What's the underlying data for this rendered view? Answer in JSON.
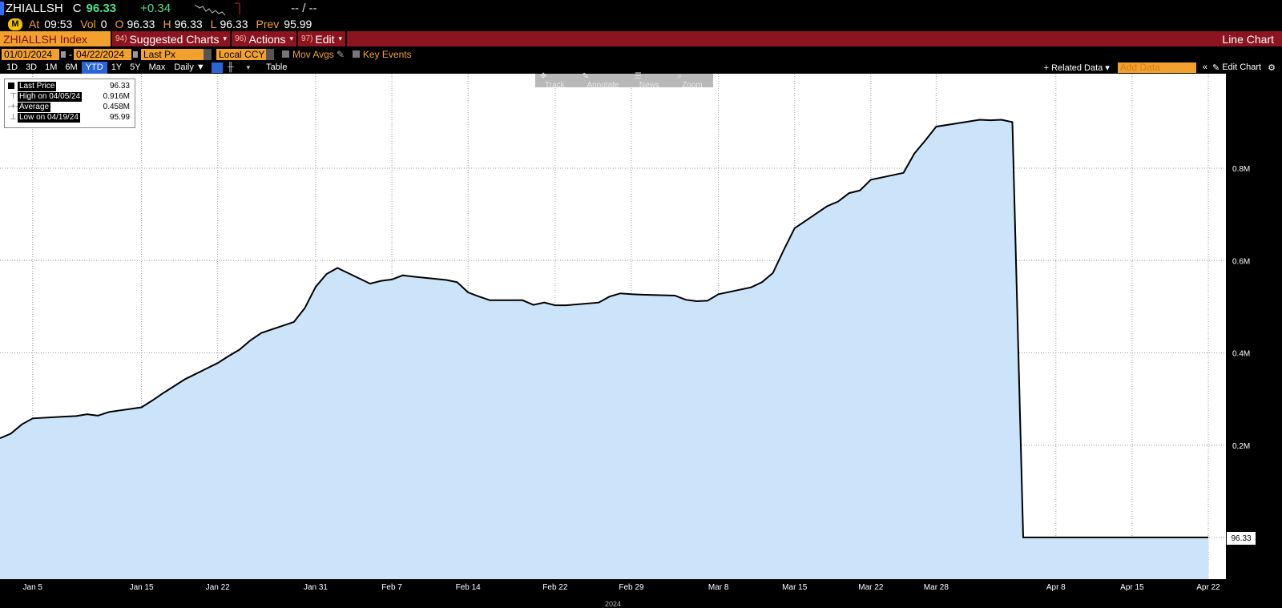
{
  "header": {
    "ticker": "ZHIALLSH",
    "c_label": "C",
    "last": "96.33",
    "change": "+0.34",
    "dashes": "-- / --",
    "at_label": "At",
    "time": "09:53",
    "vol_label": "Vol",
    "vol": "0",
    "o_label": "O",
    "open": "96.33",
    "h_label": "H",
    "high": "96.33",
    "l_label": "L",
    "low": "96.33",
    "prev_label": "Prev",
    "prev": "95.99"
  },
  "menubar": {
    "security": "ZHIALLSH Index",
    "suggested_num": "94)",
    "suggested": "Suggested Charts",
    "actions_num": "96)",
    "actions": "Actions",
    "edit_num": "97)",
    "edit": "Edit",
    "chart_type": "Line Chart"
  },
  "settings": {
    "start_date": "01/01/2024",
    "end_date": "04/22/2024",
    "field": "Last Px",
    "currency": "Local CCY",
    "mov_avgs": "Mov Avgs",
    "key_events": "Key Events"
  },
  "ranges": {
    "items": [
      "1D",
      "3D",
      "1M",
      "6M",
      "YTD",
      "1Y",
      "5Y",
      "Max"
    ],
    "selected": "YTD",
    "period": "Daily ▼",
    "table": "Table",
    "related": "+ Related Data ▾",
    "add_data_placeholder": "Add Data",
    "edit_chart": "Edit Chart"
  },
  "tools": {
    "track": "Track",
    "annotate": "Annotate",
    "news": "News",
    "zoom": "Zoom"
  },
  "legend": {
    "last_label": "Last Price",
    "last_val": "96.33",
    "high_label": "High on 04/05/24",
    "high_val": "0.916M",
    "avg_label": "Average",
    "avg_val": "0.458M",
    "low_label": "Low on 04/19/24",
    "low_val": "95.99"
  },
  "colors": {
    "fill": "#cce4fa",
    "line": "#000000",
    "menubar": "#8b1420",
    "accent": "#f3a12e",
    "green": "#4ee08a"
  },
  "chart_data": {
    "type": "area",
    "x": [
      "2024-01-02",
      "2024-01-03",
      "2024-01-04",
      "2024-01-05",
      "2024-01-08",
      "2024-01-09",
      "2024-01-10",
      "2024-01-11",
      "2024-01-12",
      "2024-01-15",
      "2024-01-16",
      "2024-01-17",
      "2024-01-18",
      "2024-01-19",
      "2024-01-22",
      "2024-01-23",
      "2024-01-24",
      "2024-01-25",
      "2024-01-26",
      "2024-01-29",
      "2024-01-30",
      "2024-01-31",
      "2024-02-01",
      "2024-02-02",
      "2024-02-05",
      "2024-02-06",
      "2024-02-07",
      "2024-02-08",
      "2024-02-09",
      "2024-02-12",
      "2024-02-13",
      "2024-02-14",
      "2024-02-15",
      "2024-02-16",
      "2024-02-19",
      "2024-02-20",
      "2024-02-21",
      "2024-02-22",
      "2024-02-23",
      "2024-02-26",
      "2024-02-27",
      "2024-02-28",
      "2024-02-29",
      "2024-03-01",
      "2024-03-04",
      "2024-03-05",
      "2024-03-06",
      "2024-03-07",
      "2024-03-08",
      "2024-03-11",
      "2024-03-12",
      "2024-03-13",
      "2024-03-14",
      "2024-03-15",
      "2024-03-18",
      "2024-03-19",
      "2024-03-20",
      "2024-03-21",
      "2024-03-22",
      "2024-03-25",
      "2024-03-26",
      "2024-03-27",
      "2024-03-28",
      "2024-04-01",
      "2024-04-02",
      "2024-04-03",
      "2024-04-04",
      "2024-04-05",
      "2024-04-08",
      "2024-04-09",
      "2024-04-10",
      "2024-04-11",
      "2024-04-12",
      "2024-04-15",
      "2024-04-16",
      "2024-04-17",
      "2024-04-18",
      "2024-04-19",
      "2024-04-22"
    ],
    "series": [
      {
        "values": [
          0.215,
          0.225,
          0.245,
          0.258,
          0.262,
          0.263,
          0.267,
          0.264,
          0.272,
          0.282,
          0.297,
          0.313,
          0.328,
          0.343,
          0.378,
          0.393,
          0.407,
          0.427,
          0.443,
          0.467,
          0.497,
          0.543,
          0.571,
          0.584,
          0.55,
          0.556,
          0.559,
          0.568,
          0.565,
          0.558,
          0.553,
          0.531,
          0.522,
          0.514,
          0.514,
          0.504,
          0.509,
          0.503,
          0.503,
          0.509,
          0.522,
          0.529,
          0.527,
          0.526,
          0.524,
          0.515,
          0.512,
          0.513,
          0.527,
          0.542,
          0.553,
          0.573,
          0.623,
          0.67,
          0.718,
          0.728,
          0.746,
          0.752,
          0.775,
          0.79,
          0.832,
          0.86,
          0.89,
          0.905,
          0.904,
          0.905,
          0.9,
          0.0001,
          0.0001,
          0.0001,
          0.0001,
          0.0001,
          0.0001,
          0.0001,
          0.0001,
          0.0001,
          0.0001,
          0.0001,
          0.0001
        ]
      }
    ],
    "x_ticks": [
      "Jan 5",
      "Jan 15",
      "Jan 22",
      "Jan 31",
      "Feb 7",
      "Feb 14",
      "Feb 22",
      "Feb 29",
      "Mar 8",
      "Mar 15",
      "Mar 22",
      "Mar 28",
      "Apr 8",
      "Apr 15",
      "Apr 22"
    ],
    "x_tick_dates": [
      "2024-01-05",
      "2024-01-15",
      "2024-01-22",
      "2024-01-31",
      "2024-02-07",
      "2024-02-14",
      "2024-02-22",
      "2024-02-29",
      "2024-03-08",
      "2024-03-15",
      "2024-03-22",
      "2024-03-28",
      "2024-04-08",
      "2024-04-15",
      "2024-04-22"
    ],
    "xlabel": "2024",
    "y_ticks": [
      "0.2M",
      "0.4M",
      "0.6M",
      "0.8M"
    ],
    "y_tick_values": [
      0.2,
      0.4,
      0.6,
      0.8
    ],
    "yunit": "M",
    "ylim": [
      0,
      1.0
    ],
    "last_price_tag": "96.33",
    "grid": true,
    "legend_position": "top-left"
  }
}
